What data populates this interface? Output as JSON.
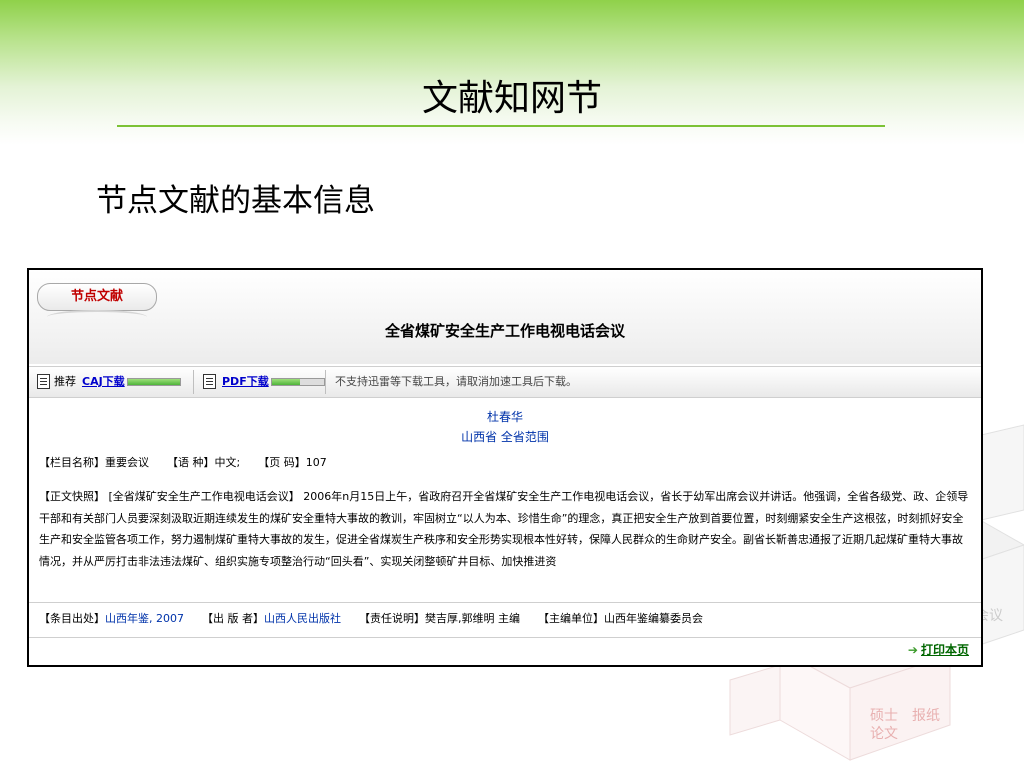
{
  "slide": {
    "title": "文献知网节",
    "subtitle": "节点文献的基本信息"
  },
  "colors": {
    "accent_green": "#7cc236",
    "link_blue": "#0000cc",
    "badge_red": "#c00000"
  },
  "panel": {
    "badge": "节点文献",
    "article_title": "全省煤矿安全生产工作电视电话会议",
    "toolbar": {
      "recommend": "推荐",
      "caj_label": "CAJ下载",
      "pdf_label": "PDF下载",
      "note": "不支持迅雷等下载工具，请取消加速工具后下载。",
      "caj_progress": 1.0,
      "pdf_progress": 0.55
    },
    "author": "杜春华",
    "affiliation": "山西省  全省范围",
    "meta": {
      "column_key": "【栏目名称】",
      "column_val": "重要会议",
      "lang_key": "【语  种】",
      "lang_val": "中文;",
      "page_key": "【页  码】",
      "page_val": "107"
    },
    "abstract": "【正文快照】 [全省煤矿安全生产工作电视电话会议】 2006年n月15日上午，省政府召开全省煤矿安全生产工作电视电话会议，省长于幼军出席会议并讲话。他强调，全省各级党、政、企领导干部和有关部门人员要深刻汲取近期连续发生的煤矿安全重特大事故的教训，牢固树立“以人为本、珍惜生命”的理念，真正把安全生产放到首要位置，时刻绷紧安全生产这根弦，时刻抓好安全生产和安全监管各项工作，努力遏制煤矿重特大事故的发生，促进全省煤炭生产秩序和安全形势实现根本性好转，保障人民群众的生命财产安全。副省长靳善忠通报了近期几起煤矿重特大事故情况，并从严厉打击非法违法煤矿、组织实施专项整治行动“回头看”、实现关闭整顿矿井目标、加快推进资",
    "source": {
      "src_key": "【条目出处】",
      "src_val": "山西年鉴, 2007",
      "pub_key": "【出 版 者】",
      "pub_val": "山西人民出版社",
      "resp_key": "【责任说明】",
      "resp_val": "樊吉厚,郭维明 主编",
      "editor_key": "【主编单位】",
      "editor_val": "山西年鉴编纂委员会"
    },
    "print_label": "打印本页"
  },
  "decor": {
    "cube_text_1": "硕士",
    "cube_text_2": "论文",
    "cube_text_3": "报纸",
    "cube_text_4": "会议"
  }
}
